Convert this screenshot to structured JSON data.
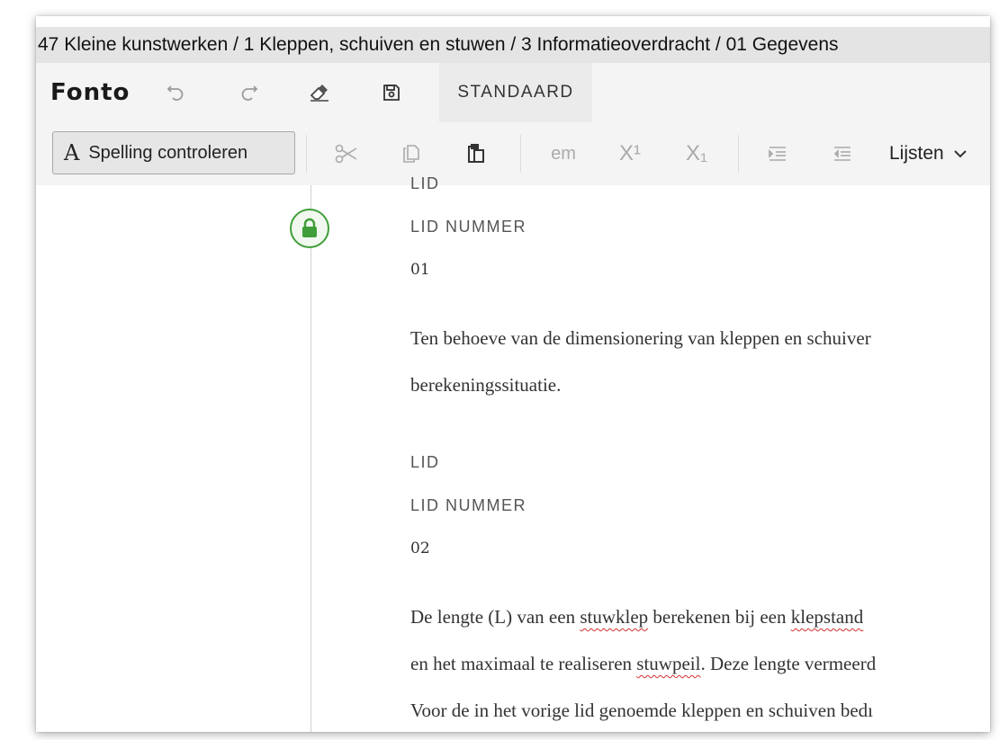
{
  "breadcrumb": "47 Kleine kunstwerken / 1 Kleppen, schuiven en stuwen / 3 Informatieoverdracht / 01 Gegevens",
  "menubar": {
    "logo": "Fonto",
    "tab_label": "STANDAARD"
  },
  "toolbar": {
    "spell_icon": "A",
    "spell_label": "Spelling controleren",
    "em_label": "em",
    "superscript_label": "X¹",
    "subscript_label": "X₁",
    "lists_label": "Lijsten"
  },
  "document": {
    "clipped_label": "LID",
    "lid1": {
      "nummer_label": "LID NUMMER",
      "nummer": "01",
      "lines": [
        "Ten behoeve van de dimensionering van kleppen en schuiver",
        "berekeningssituatie."
      ]
    },
    "lid2": {
      "label": "LID",
      "nummer_label": "LID NUMMER",
      "nummer": "02",
      "line1": {
        "a": " De lengte (L) van een ",
        "b": "stuwklep",
        "c": " berekenen bij een ",
        "d": "klepstand"
      },
      "line2": {
        "a": "en het maximaal te realiseren ",
        "b": "stuwpeil",
        "c": ". Deze lengte vermeerd"
      },
      "line3": "Voor de in het vorige lid genoemde kleppen en schuiven bedı"
    }
  },
  "colors": {
    "lock_green": "#3f9e3a",
    "spell_error": "#d32f2f"
  }
}
